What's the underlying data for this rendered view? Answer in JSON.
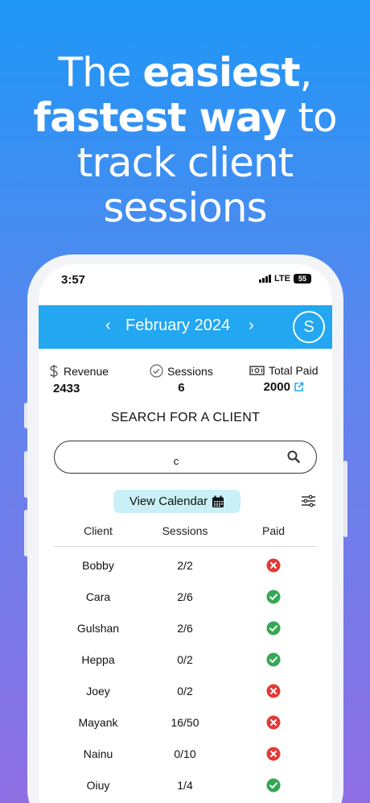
{
  "headline": {
    "line1_prefix": "The ",
    "line1_bold": "easiest",
    "line1_suffix": ",",
    "line2_bold": "fastest way",
    "line2_suffix": " to",
    "line3": "track client",
    "line4": "sessions"
  },
  "status_bar": {
    "time": "3:57",
    "network": "LTE",
    "battery": "55"
  },
  "app_bar": {
    "prev_icon": "chevron-left-icon",
    "month": "February 2024",
    "next_icon": "chevron-right-icon",
    "avatar_letter": "S"
  },
  "stats": {
    "revenue_label": "Revenue",
    "revenue_value": "2433",
    "sessions_label": "Sessions",
    "sessions_value": "6",
    "paid_label": "Total Paid",
    "paid_value": "2000"
  },
  "search": {
    "title": "SEARCH FOR A CLIENT",
    "value": "c",
    "placeholder": ""
  },
  "view_calendar_label": "View Calendar",
  "table": {
    "headers": [
      "Client",
      "Sessions",
      "Paid"
    ],
    "rows": [
      {
        "client": "Bobby",
        "sessions": "2/2",
        "paid": false
      },
      {
        "client": "Cara",
        "sessions": "2/6",
        "paid": true
      },
      {
        "client": "Gulshan",
        "sessions": "2/6",
        "paid": true
      },
      {
        "client": "Heppa",
        "sessions": "0/2",
        "paid": true
      },
      {
        "client": "Joey",
        "sessions": "0/2",
        "paid": false
      },
      {
        "client": "Mayank",
        "sessions": "16/50",
        "paid": false
      },
      {
        "client": "Nainu",
        "sessions": "0/10",
        "paid": false
      },
      {
        "client": "Oiuy",
        "sessions": "1/4",
        "paid": true
      }
    ]
  },
  "colors": {
    "app_bar": "#22a7f0",
    "paid_yes": "#34a853",
    "paid_no": "#e53935",
    "view_calendar_bg": "#c9f0f6"
  }
}
